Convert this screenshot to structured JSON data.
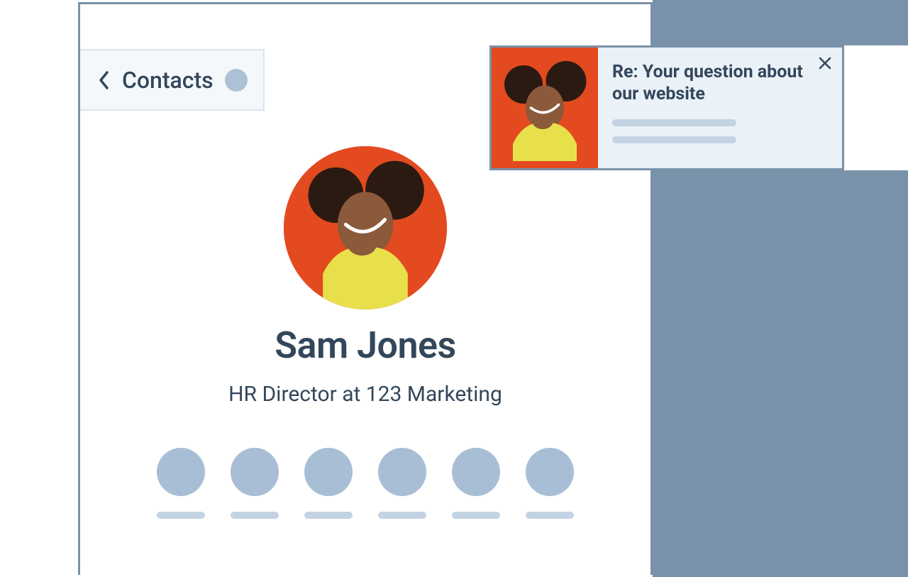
{
  "breadcrumb": {
    "label": "Contacts"
  },
  "contact": {
    "name": "Sam Jones",
    "title": "HR Director at 123 Marketing"
  },
  "notification": {
    "subject": "Re: Your question about our website"
  },
  "colors": {
    "muted_blue": "#7992aa",
    "text": "#33475b",
    "avatar_bg": "#e34a1f",
    "placeholder_circle": "#a8bed5",
    "placeholder_bar": "#c3d3e3",
    "panel_light": "#eaf1f7"
  },
  "action_placeholders": 6
}
